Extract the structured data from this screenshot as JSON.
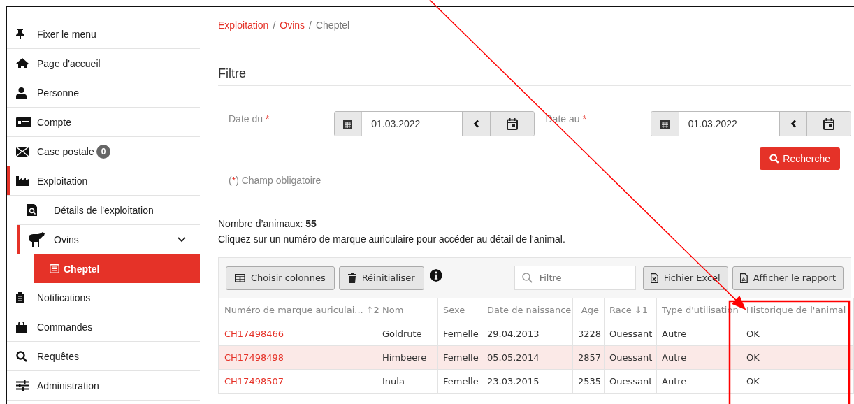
{
  "sidebar": {
    "items": [
      {
        "label": "Fixer le menu",
        "active": false,
        "selected": false
      },
      {
        "label": "Page d'accueil",
        "active": false,
        "selected": false
      },
      {
        "label": "Personne",
        "active": false,
        "selected": false
      },
      {
        "label": "Compte",
        "active": false,
        "selected": false
      },
      {
        "label": "Case postale",
        "badge": "0",
        "active": false,
        "selected": false
      },
      {
        "label": "Exploitation",
        "active": true,
        "selected": false,
        "children": [
          {
            "label": "Détails de l'exploitation",
            "active": false,
            "selected": false
          },
          {
            "label": "Ovins",
            "active": true,
            "selected": false,
            "expanded": true,
            "children": [
              {
                "label": "Cheptel",
                "selected": true
              }
            ]
          }
        ]
      },
      {
        "label": "Notifications",
        "active": false,
        "selected": false
      },
      {
        "label": "Commandes",
        "active": false,
        "selected": false
      },
      {
        "label": "Requêtes",
        "active": false,
        "selected": false
      },
      {
        "label": "Administration",
        "active": false,
        "selected": false
      }
    ]
  },
  "breadcrumb": [
    {
      "label": "Exploitation",
      "link": true,
      "separator": "/"
    },
    {
      "label": "Ovins",
      "link": true,
      "separator": "/"
    },
    {
      "label": "Cheptel",
      "link": false
    }
  ],
  "filter": {
    "title": "Filtre",
    "fields": [
      {
        "label": "Date du",
        "required_mark": "*",
        "value": "01.03.2022"
      },
      {
        "label": "Date au",
        "required_mark": "*",
        "value": "01.03.2022"
      }
    ],
    "search_button": "Recherche",
    "note": {
      "open": "(",
      "mark": "*",
      "text": ") Champ obligatoire"
    }
  },
  "summary": {
    "count": "Nombre d’animaux: **55**",
    "hint": "Cliquez sur un numéro de marque auriculaire pour accéder au détail de l'animal."
  },
  "table": {
    "toolbar": {
      "left_buttons": [
        "Choisir colonnes",
        "Réinitialiser"
      ],
      "search_placeholder": "Filtre",
      "right_buttons": [
        "Fichier Excel",
        "Afficher le rapport"
      ]
    },
    "columns": [
      {
        "label": "Numéro de marque auriculai...",
        "sort": "↑2"
      },
      {
        "label": "Nom"
      },
      {
        "label": "Sexe"
      },
      {
        "label": "Date de naissance"
      },
      {
        "label": "Age"
      },
      {
        "label": "Race",
        "sort": "↓1"
      },
      {
        "label": "Type d'utilisation"
      },
      {
        "label": "Historique de l'animal"
      }
    ],
    "rows": [
      {
        "highlighted": false,
        "cells": [
          "CH17498466",
          "Goldrute",
          "Femelle",
          "29.04.2013",
          "3228",
          "Ouessant",
          "Autre",
          "OK"
        ]
      },
      {
        "highlighted": true,
        "cells": [
          "CH17498498",
          "Himbeere",
          "Femelle",
          "05.05.2014",
          "2857",
          "Ouessant",
          "Autre",
          "OK"
        ]
      },
      {
        "highlighted": false,
        "cells": [
          "CH17498507",
          "Inula",
          "Femelle",
          "23.03.2015",
          "2535",
          "Ouessant",
          "Autre",
          "OK"
        ]
      }
    ]
  },
  "annotations": [
    {
      "kind": "arrow"
    },
    {
      "kind": "box"
    }
  ]
}
